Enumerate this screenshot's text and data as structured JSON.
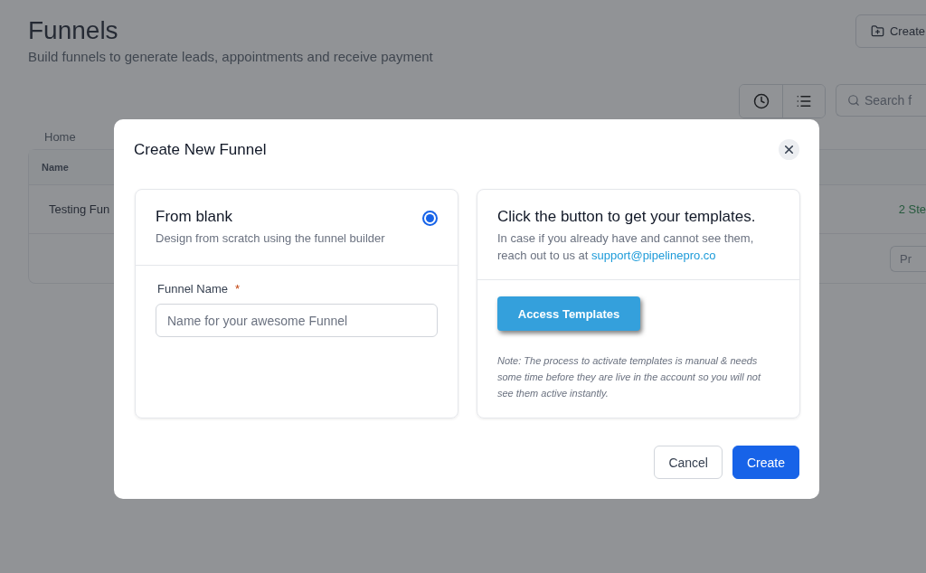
{
  "page": {
    "title": "Funnels",
    "subtitle": "Build funnels to generate leads, appointments and receive payment",
    "create_button": "Create",
    "search": {
      "placeholder": "Search f"
    },
    "breadcrumb": "Home"
  },
  "table": {
    "columns": [
      "Name"
    ],
    "rows": [
      {
        "name": "Testing Fun",
        "column_2": "2 Ste"
      }
    ],
    "footer_button": "Pr"
  },
  "modal": {
    "title": "Create New Funnel",
    "blank_option": {
      "title": "From blank",
      "description": "Design from scratch using the funnel builder",
      "selected": true,
      "field": {
        "label": "Funnel Name",
        "required_mark": "*",
        "placeholder": "Name for your awesome Funnel"
      }
    },
    "templates_option": {
      "title": "Click the button to get your templates.",
      "text": "In case if you already have and cannot see them, reach out to us at",
      "link": "support@pipelinepro.co",
      "button": "Access Templates",
      "note": "Note: The process to activate templates is manual & needs some time before they are live in the account so you will not see them active instantly."
    },
    "buttons": [
      {
        "label": "Cancel",
        "kind": "secondary"
      },
      {
        "label": "Create",
        "kind": "primary"
      }
    ]
  }
}
